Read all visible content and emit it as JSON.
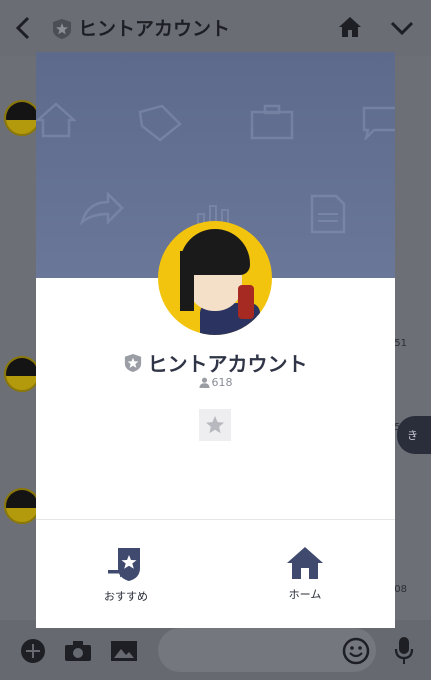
{
  "header": {
    "title": "ヒントアカウント"
  },
  "modal": {
    "account_name": "ヒントアカウント",
    "friend_count": "618",
    "actions": [
      {
        "label": "おすすめ",
        "icon": "recommend-icon"
      },
      {
        "label": "ホーム",
        "icon": "home-icon"
      }
    ]
  },
  "background": {
    "timestamps": [
      "51",
      "51",
      "08"
    ],
    "side_bubble_text": "き"
  },
  "colors": {
    "cover": "#5d6a8c",
    "avatar_bg": "#f3c40e",
    "icon_navy": "#3f4a6e",
    "badge_gray": "#8e9198"
  }
}
